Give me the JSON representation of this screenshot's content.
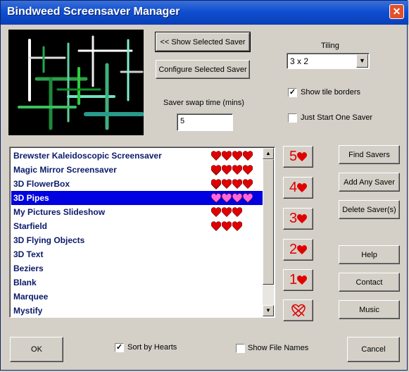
{
  "window": {
    "title": "Bindweed Screensaver Manager",
    "close_glyph": "✕"
  },
  "buttons": {
    "show_selected": "<< Show Selected Saver",
    "configure_selected": "Configure Selected Saver",
    "find_savers": "Find Savers",
    "add_any_saver": "Add Any Saver",
    "delete_savers": "Delete Saver(s)",
    "help": "Help",
    "contact": "Contact",
    "music": "Music",
    "ok": "OK",
    "cancel": "Cancel"
  },
  "tiling": {
    "label": "Tiling",
    "value": "3 x 2"
  },
  "swap": {
    "label": "Saver swap time (mins)",
    "value": "5"
  },
  "checkboxes": {
    "show_tile_borders": {
      "label": "Show tile borders",
      "checked": true
    },
    "just_start_one": {
      "label": "Just Start One Saver",
      "checked": false
    },
    "sort_by_hearts": {
      "label": "Sort by Hearts",
      "checked": true
    },
    "show_file_names": {
      "label": "Show File Names",
      "checked": false
    }
  },
  "savers": [
    {
      "name": "Brewster Kaleidoscopic Screensaver",
      "hearts": 5
    },
    {
      "name": "Magic Mirror Screensaver",
      "hearts": 5
    },
    {
      "name": "3D FlowerBox",
      "hearts": 5
    },
    {
      "name": "3D Pipes",
      "hearts": 4,
      "selected": true
    },
    {
      "name": "My Pictures Slideshow",
      "hearts": 3
    },
    {
      "name": "Starfield",
      "hearts": 3
    },
    {
      "name": "3D Flying Objects",
      "hearts": 0
    },
    {
      "name": "3D Text",
      "hearts": 0
    },
    {
      "name": "Beziers",
      "hearts": 0
    },
    {
      "name": "Blank",
      "hearts": 0
    },
    {
      "name": "Marquee",
      "hearts": 0
    },
    {
      "name": "Mystify",
      "hearts": 0
    }
  ],
  "rating_buttons": [
    "5",
    "4",
    "3",
    "2",
    "1"
  ],
  "colors": {
    "heart": "#e00000",
    "heart_selected": "#ff66dd",
    "selection": "#0000e0",
    "titlebar": "#0f4fd0"
  },
  "icons": {
    "heart": "heart-icon",
    "no_hearts": "broken-heart-icon",
    "dropdown": "chevron-down-icon"
  }
}
